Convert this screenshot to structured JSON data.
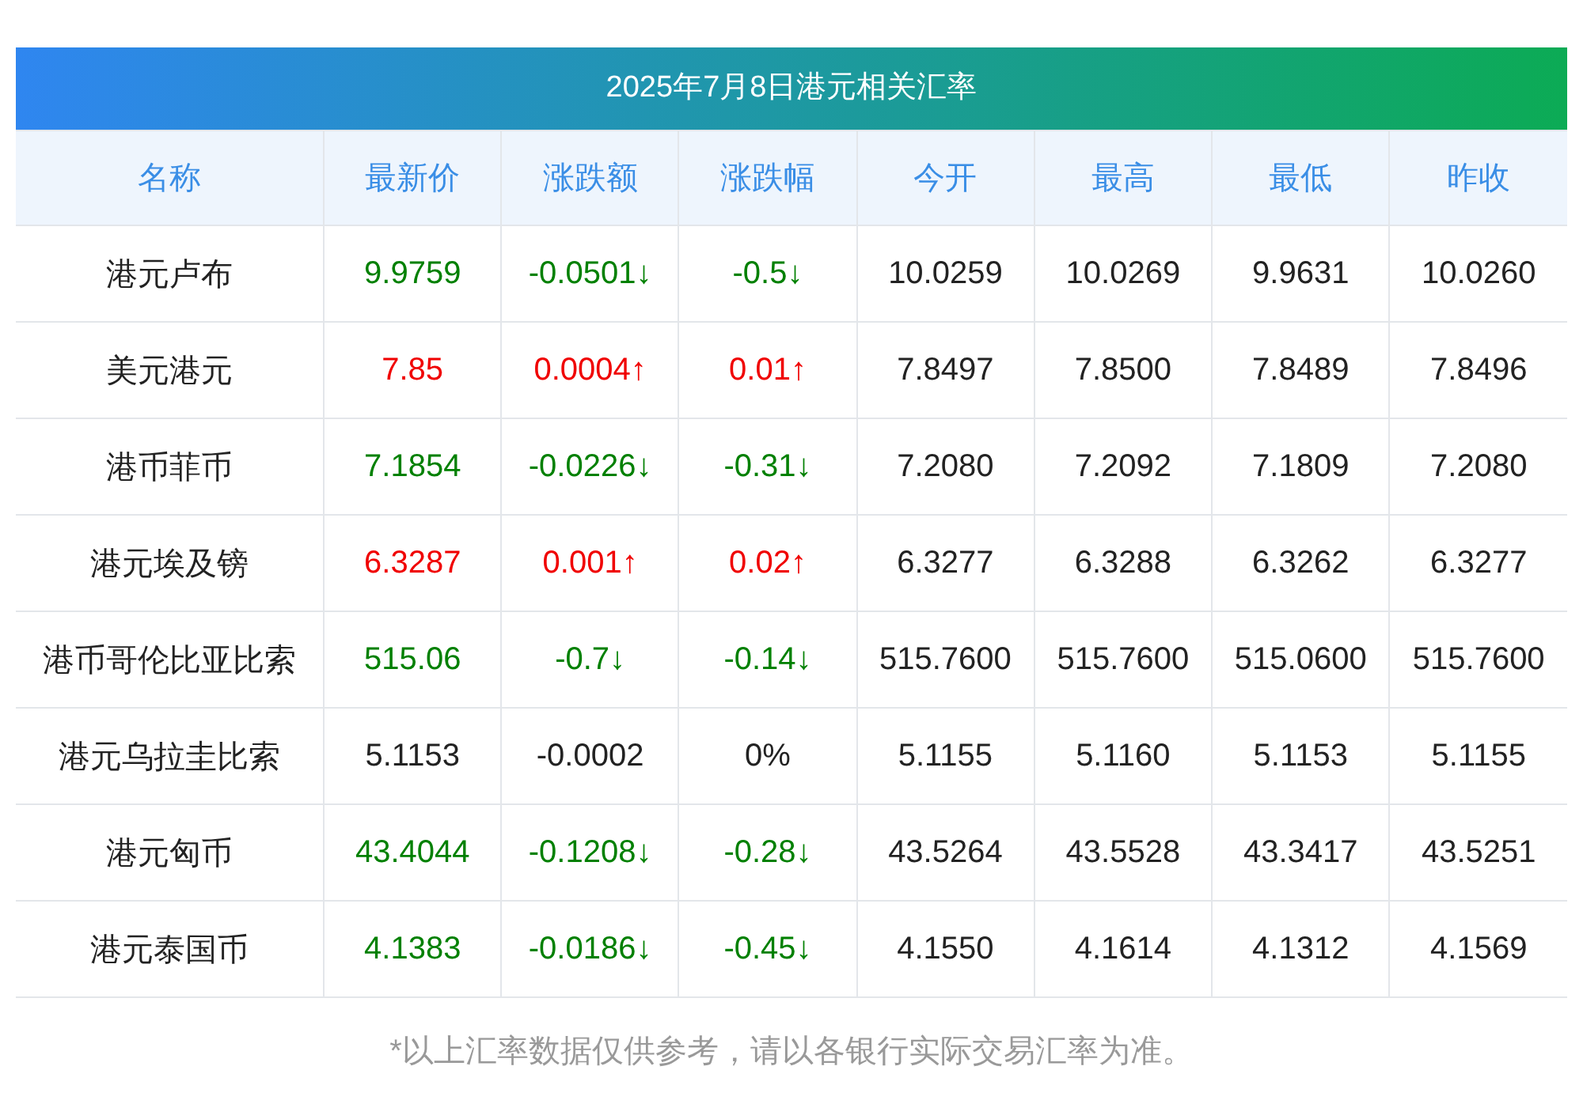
{
  "title": "2025年7月8日港元相关汇率",
  "columns": [
    "名称",
    "最新价",
    "涨跌额",
    "涨跌幅",
    "今开",
    "最高",
    "最低",
    "昨收"
  ],
  "rows": [
    {
      "kind": "down",
      "cells": [
        "港元卢布",
        "9.9759",
        "-0.0501↓",
        "-0.5↓",
        "10.0259",
        "10.0269",
        "9.9631",
        "10.0260"
      ]
    },
    {
      "kind": "up",
      "cells": [
        "美元港元",
        "7.85",
        "0.0004↑",
        "0.01↑",
        "7.8497",
        "7.8500",
        "7.8489",
        "7.8496"
      ]
    },
    {
      "kind": "down",
      "cells": [
        "港币菲币",
        "7.1854",
        "-0.0226↓",
        "-0.31↓",
        "7.2080",
        "7.2092",
        "7.1809",
        "7.2080"
      ]
    },
    {
      "kind": "up",
      "cells": [
        "港元埃及镑",
        "6.3287",
        "0.001↑",
        "0.02↑",
        "6.3277",
        "6.3288",
        "6.3262",
        "6.3277"
      ]
    },
    {
      "kind": "down",
      "cells": [
        "港币哥伦比亚比索",
        "515.06",
        "-0.7↓",
        "-0.14↓",
        "515.7600",
        "515.7600",
        "515.0600",
        "515.7600"
      ]
    },
    {
      "kind": "flat",
      "cells": [
        "港元乌拉圭比索",
        "5.1153",
        "-0.0002",
        "0%",
        "5.1155",
        "5.1160",
        "5.1153",
        "5.1155"
      ]
    },
    {
      "kind": "down",
      "cells": [
        "港元匈币",
        "43.4044",
        "-0.1208↓",
        "-0.28↓",
        "43.5264",
        "43.5528",
        "43.3417",
        "43.5251"
      ]
    },
    {
      "kind": "down",
      "cells": [
        "港元泰国币",
        "4.1383",
        "-0.0186↓",
        "-0.45↓",
        "4.1550",
        "4.1614",
        "4.1312",
        "4.1569"
      ]
    }
  ],
  "footnote": "*以上汇率数据仅供参考，请以各银行实际交易汇率为准。"
}
